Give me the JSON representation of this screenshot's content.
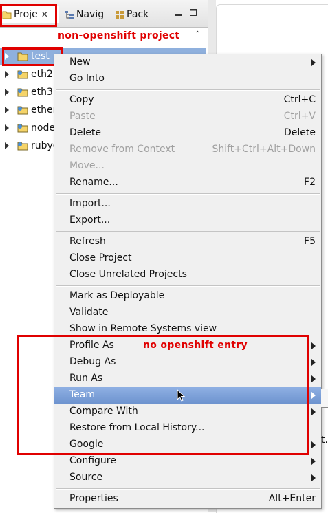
{
  "tabs": [
    {
      "label": "Proje",
      "icon": "project-explorer-icon",
      "active": true
    },
    {
      "label": "Navig",
      "icon": "navigator-icon"
    },
    {
      "label": "Pack",
      "icon": "package-explorer-icon"
    }
  ],
  "window_buttons": {
    "minimize": "minimize-icon",
    "maximize": "maximize-icon"
  },
  "annotations": {
    "top": "non-openshift project",
    "menu": "no openshift entry"
  },
  "tree": [
    {
      "label": "test",
      "selected": true
    },
    {
      "label": "eth2"
    },
    {
      "label": "eth3"
    },
    {
      "label": "ether"
    },
    {
      "label": "node"
    },
    {
      "label": "rubye"
    }
  ],
  "menu": [
    {
      "label": "New",
      "submenu": true
    },
    {
      "label": "Go Into"
    },
    {
      "separator": true
    },
    {
      "label": "Copy",
      "accel": "Ctrl+C"
    },
    {
      "label": "Paste",
      "accel": "Ctrl+V",
      "disabled": true
    },
    {
      "label": "Delete",
      "accel": "Delete"
    },
    {
      "label": "Remove from Context",
      "accel": "Shift+Ctrl+Alt+Down",
      "disabled": true
    },
    {
      "label": "Move...",
      "disabled": true
    },
    {
      "label": "Rename...",
      "accel": "F2"
    },
    {
      "separator": true
    },
    {
      "label": "Import..."
    },
    {
      "label": "Export..."
    },
    {
      "separator": true
    },
    {
      "label": "Refresh",
      "accel": "F5"
    },
    {
      "label": "Close Project"
    },
    {
      "label": "Close Unrelated Projects"
    },
    {
      "separator": true
    },
    {
      "label": "Mark as Deployable"
    },
    {
      "label": "Validate"
    },
    {
      "label": "Show in Remote Systems view"
    },
    {
      "label": "Profile As",
      "submenu": true
    },
    {
      "label": "Debug As",
      "submenu": true
    },
    {
      "label": "Run As",
      "submenu": true
    },
    {
      "label": "Team",
      "submenu": true,
      "highlighted": true
    },
    {
      "label": "Compare With",
      "submenu": true
    },
    {
      "label": "Restore from Local History..."
    },
    {
      "label": "Google",
      "submenu": true
    },
    {
      "label": "Configure",
      "submenu": true
    },
    {
      "label": "Source",
      "submenu": true
    },
    {
      "separator": true
    },
    {
      "label": "Properties",
      "accel": "Alt+Enter"
    }
  ],
  "edge_text": "t.c",
  "colors": {
    "annotation": "#e00000",
    "selection": "#8fb0dd",
    "highlight": "#7aa0d8"
  }
}
